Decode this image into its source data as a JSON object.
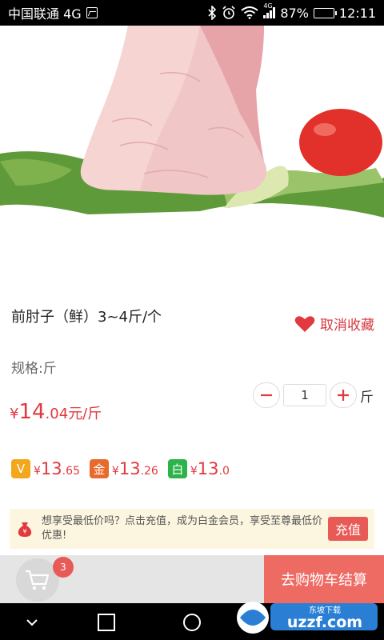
{
  "status_bar": {
    "carrier": "中国联通 4G",
    "network_label": "4G",
    "battery": "87%",
    "battery_level": 0.87,
    "time": "12:11"
  },
  "product": {
    "title": "前肘子（鲜）3~4斤/个",
    "favorite_label": "取消收藏",
    "spec": "规格:斤",
    "price": {
      "currency": "¥",
      "integer": "14",
      "decimal": ".04",
      "unit": "元/斤"
    },
    "quantity": "1",
    "quantity_unit": "斤",
    "tiers": [
      {
        "badge": "V",
        "color": "#f2a71d",
        "currency": "¥",
        "integer": "13",
        "decimal": ".65"
      },
      {
        "badge": "金",
        "color": "#e86a2c",
        "currency": "¥",
        "integer": "13",
        "decimal": ".26"
      },
      {
        "badge": "白",
        "color": "#2db34a",
        "currency": "¥",
        "integer": "13",
        "decimal": ".0"
      }
    ]
  },
  "promo": {
    "text": "想享受最低价吗？点击充值，成为白金会员，享受至尊最低价优惠!",
    "button": "充值"
  },
  "bottom_bar": {
    "cart_count": "3",
    "checkout_label": "去购物车结算"
  },
  "watermark": {
    "text": "uzzf.com",
    "subtext": "东坡下载"
  },
  "colors": {
    "accent": "#e2383f",
    "checkout": "#ee6b64",
    "promo_bg": "#fcf6e0"
  }
}
